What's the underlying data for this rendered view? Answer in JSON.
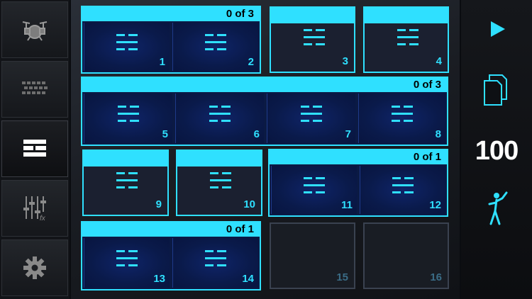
{
  "sidebar": {
    "items": [
      {
        "name": "drums",
        "icon": "drum-kit-icon"
      },
      {
        "name": "pattern",
        "icon": "step-grid-icon"
      },
      {
        "name": "pads",
        "icon": "pad-layout-icon",
        "active": true
      },
      {
        "name": "mixer",
        "icon": "mixer-fx-icon",
        "fx_label": "fx"
      },
      {
        "name": "settings",
        "icon": "gear-icon"
      }
    ]
  },
  "groups": [
    {
      "count": "0 of 3"
    },
    {
      "count": "0 of 3"
    },
    {
      "count": "0 of 1"
    },
    {
      "count": "0 of 1"
    }
  ],
  "pads": [
    {
      "num": "1"
    },
    {
      "num": "2"
    },
    {
      "num": "3"
    },
    {
      "num": "4"
    },
    {
      "num": "5"
    },
    {
      "num": "6"
    },
    {
      "num": "7"
    },
    {
      "num": "8"
    },
    {
      "num": "9"
    },
    {
      "num": "10"
    },
    {
      "num": "11"
    },
    {
      "num": "12"
    },
    {
      "num": "13"
    },
    {
      "num": "14"
    },
    {
      "num": "15"
    },
    {
      "num": "16"
    }
  ],
  "right_panel": {
    "tempo": "100",
    "play_icon": "play-icon",
    "copy_icon": "copy-pages-icon",
    "tap_icon": "swing-figure-icon"
  },
  "colors": {
    "accent": "#2fe0ff",
    "pad_bg": "#0b1a44"
  }
}
